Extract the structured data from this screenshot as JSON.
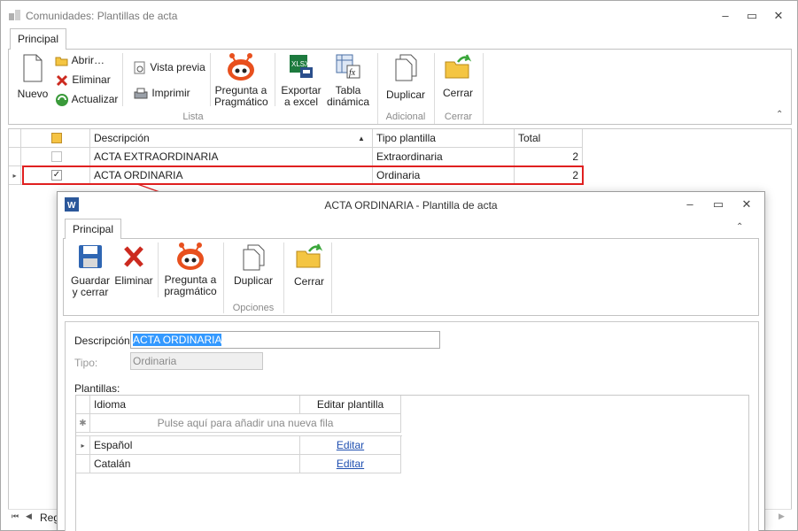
{
  "window": {
    "title": "Comunidades: Plantillas de acta",
    "buttons": {
      "minimize": "–",
      "restore": "▭",
      "close": "✕"
    }
  },
  "ribbon": {
    "tab": "Principal",
    "nuevo": "Nuevo",
    "abrir": "Abrir…",
    "eliminar": "Eliminar",
    "actualizar": "Actualizar",
    "vista_previa": "Vista previa",
    "imprimir": "Imprimir",
    "pregunta_line1": "Pregunta a",
    "pregunta_line2": "Pragmático",
    "exportar_line1": "Exportar",
    "exportar_line2": "a excel",
    "tabla_line1": "Tabla",
    "tabla_line2": "dinámica",
    "duplicar": "Duplicar",
    "cerrar": "Cerrar",
    "groups": {
      "lista": "Lista",
      "adicional": "Adicional",
      "cerrar": "Cerrar"
    }
  },
  "grid": {
    "columns": [
      "Descripción",
      "Tipo plantilla",
      "Total"
    ],
    "rows": [
      {
        "descripcion": "ACTA EXTRAORDINARIA",
        "tipo": "Extraordinaria",
        "total": "2",
        "checked": false
      },
      {
        "descripcion": "ACTA ORDINARIA",
        "tipo": "Ordinaria",
        "total": "2",
        "checked": true
      }
    ],
    "nav_label": "Reg"
  },
  "dialog": {
    "title": "ACTA ORDINARIA - Plantilla de acta",
    "tab": "Principal",
    "guardar_line1": "Guardar",
    "guardar_line2": "y cerrar",
    "eliminar": "Eliminar",
    "pregunta_line1": "Pregunta a",
    "pregunta_line2": "pragmático",
    "duplicar": "Duplicar",
    "cerrar": "Cerrar",
    "group_opciones": "Opciones",
    "descripcion_label": "Descripción:",
    "descripcion_value": "ACTA ORDINARIA",
    "tipo_label": "Tipo:",
    "tipo_value": "Ordinaria",
    "plantillas_label": "Plantillas:",
    "subgrid": {
      "columns": [
        "Idioma",
        "Editar plantilla"
      ],
      "new_row_hint": "Pulse aquí para añadir una nueva fila",
      "rows": [
        {
          "idioma": "Español",
          "editar": "Editar"
        },
        {
          "idioma": "Catalán",
          "editar": "Editar"
        }
      ]
    }
  },
  "colors": {
    "highlight": "#e02020",
    "selection": "#3399ff",
    "accent": "#1f4fb0"
  }
}
